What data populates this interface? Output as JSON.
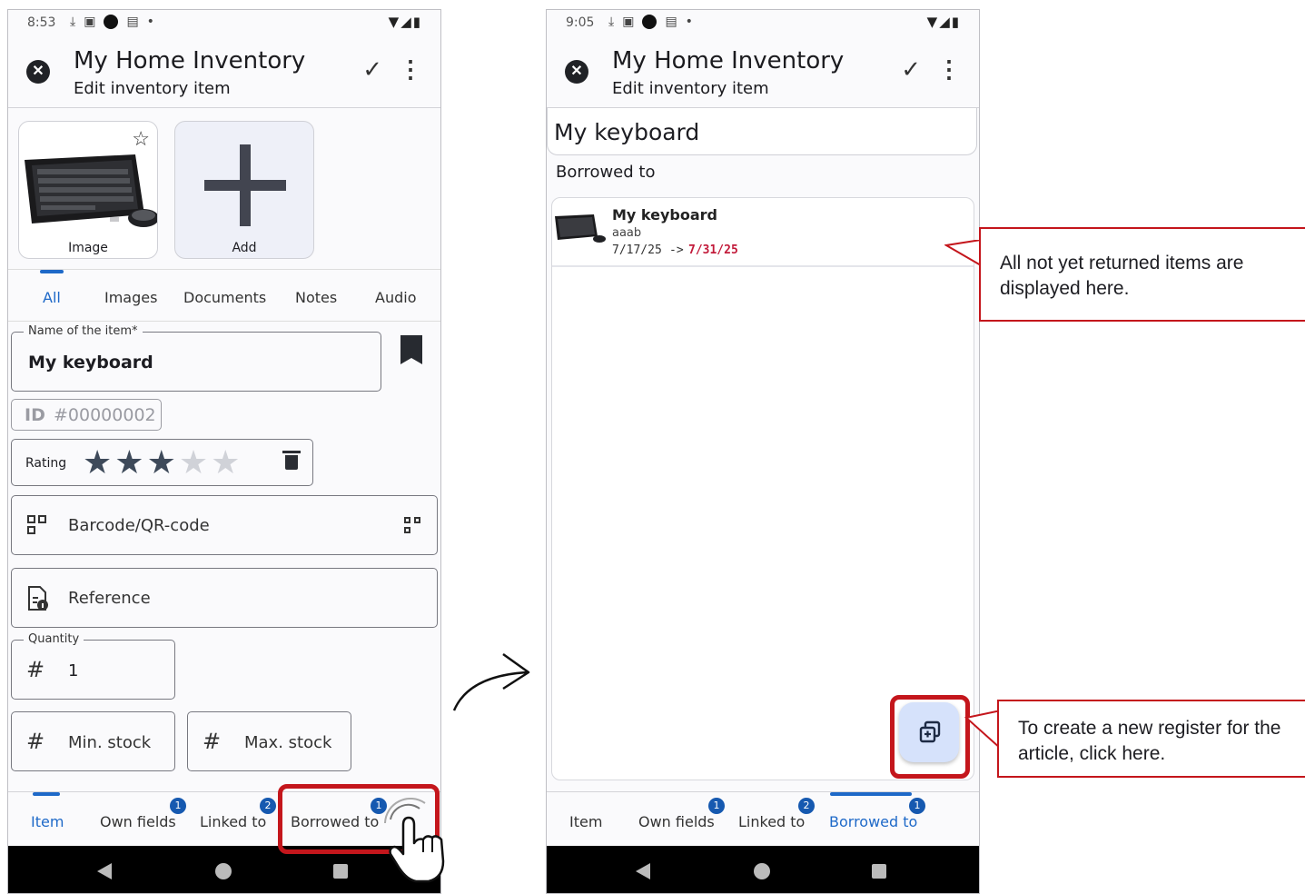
{
  "left_screen": {
    "status": {
      "time": "8:53"
    },
    "appbar": {
      "title": "My Home Inventory",
      "subtitle": "Edit inventory item"
    },
    "image_card_label": "Image",
    "add_card_label": "Add",
    "tabs": [
      {
        "label": "All",
        "active": true
      },
      {
        "label": "Images"
      },
      {
        "label": "Documents"
      },
      {
        "label": "Notes"
      },
      {
        "label": "Audio"
      }
    ],
    "name_field": {
      "label": "Name of the item*",
      "value": "My keyboard"
    },
    "id_field": {
      "prefix": "ID",
      "value": "#00000002"
    },
    "rating": {
      "label": "Rating",
      "value": 3,
      "max": 5
    },
    "barcode_placeholder": "Barcode/QR-code",
    "reference_placeholder": "Reference",
    "quantity": {
      "label": "Quantity",
      "value": "1"
    },
    "min_stock_placeholder": "Min. stock",
    "max_stock_placeholder": "Max. stock",
    "bottom_nav": [
      {
        "label": "Item",
        "active": true
      },
      {
        "label": "Own fields",
        "badge": "1"
      },
      {
        "label": "Linked to",
        "badge": "2"
      },
      {
        "label": "Borrowed to",
        "badge": "1"
      }
    ]
  },
  "right_screen": {
    "status": {
      "time": "9:05"
    },
    "appbar": {
      "title": "My Home Inventory",
      "subtitle": "Edit inventory item"
    },
    "item_title": "My keyboard",
    "section_label": "Borrowed to",
    "borrow_entry": {
      "name": "My keyboard",
      "borrower": "aaab",
      "date_from": "7/17/25",
      "arrow": "->",
      "date_to": "7/31/25"
    },
    "bottom_nav": [
      {
        "label": "Item"
      },
      {
        "label": "Own fields",
        "badge": "1"
      },
      {
        "label": "Linked to",
        "badge": "2"
      },
      {
        "label": "Borrowed to",
        "badge": "1",
        "active": true
      }
    ]
  },
  "callouts": {
    "top": "All not yet returned items are displayed here.",
    "bottom": "To create a new register for the article, click here."
  },
  "colors": {
    "accent_blue": "#1e69c8",
    "highlight_red": "#c4161c",
    "return_date_red": "#c21a3a",
    "fab_bg": "#d6e2fb"
  }
}
